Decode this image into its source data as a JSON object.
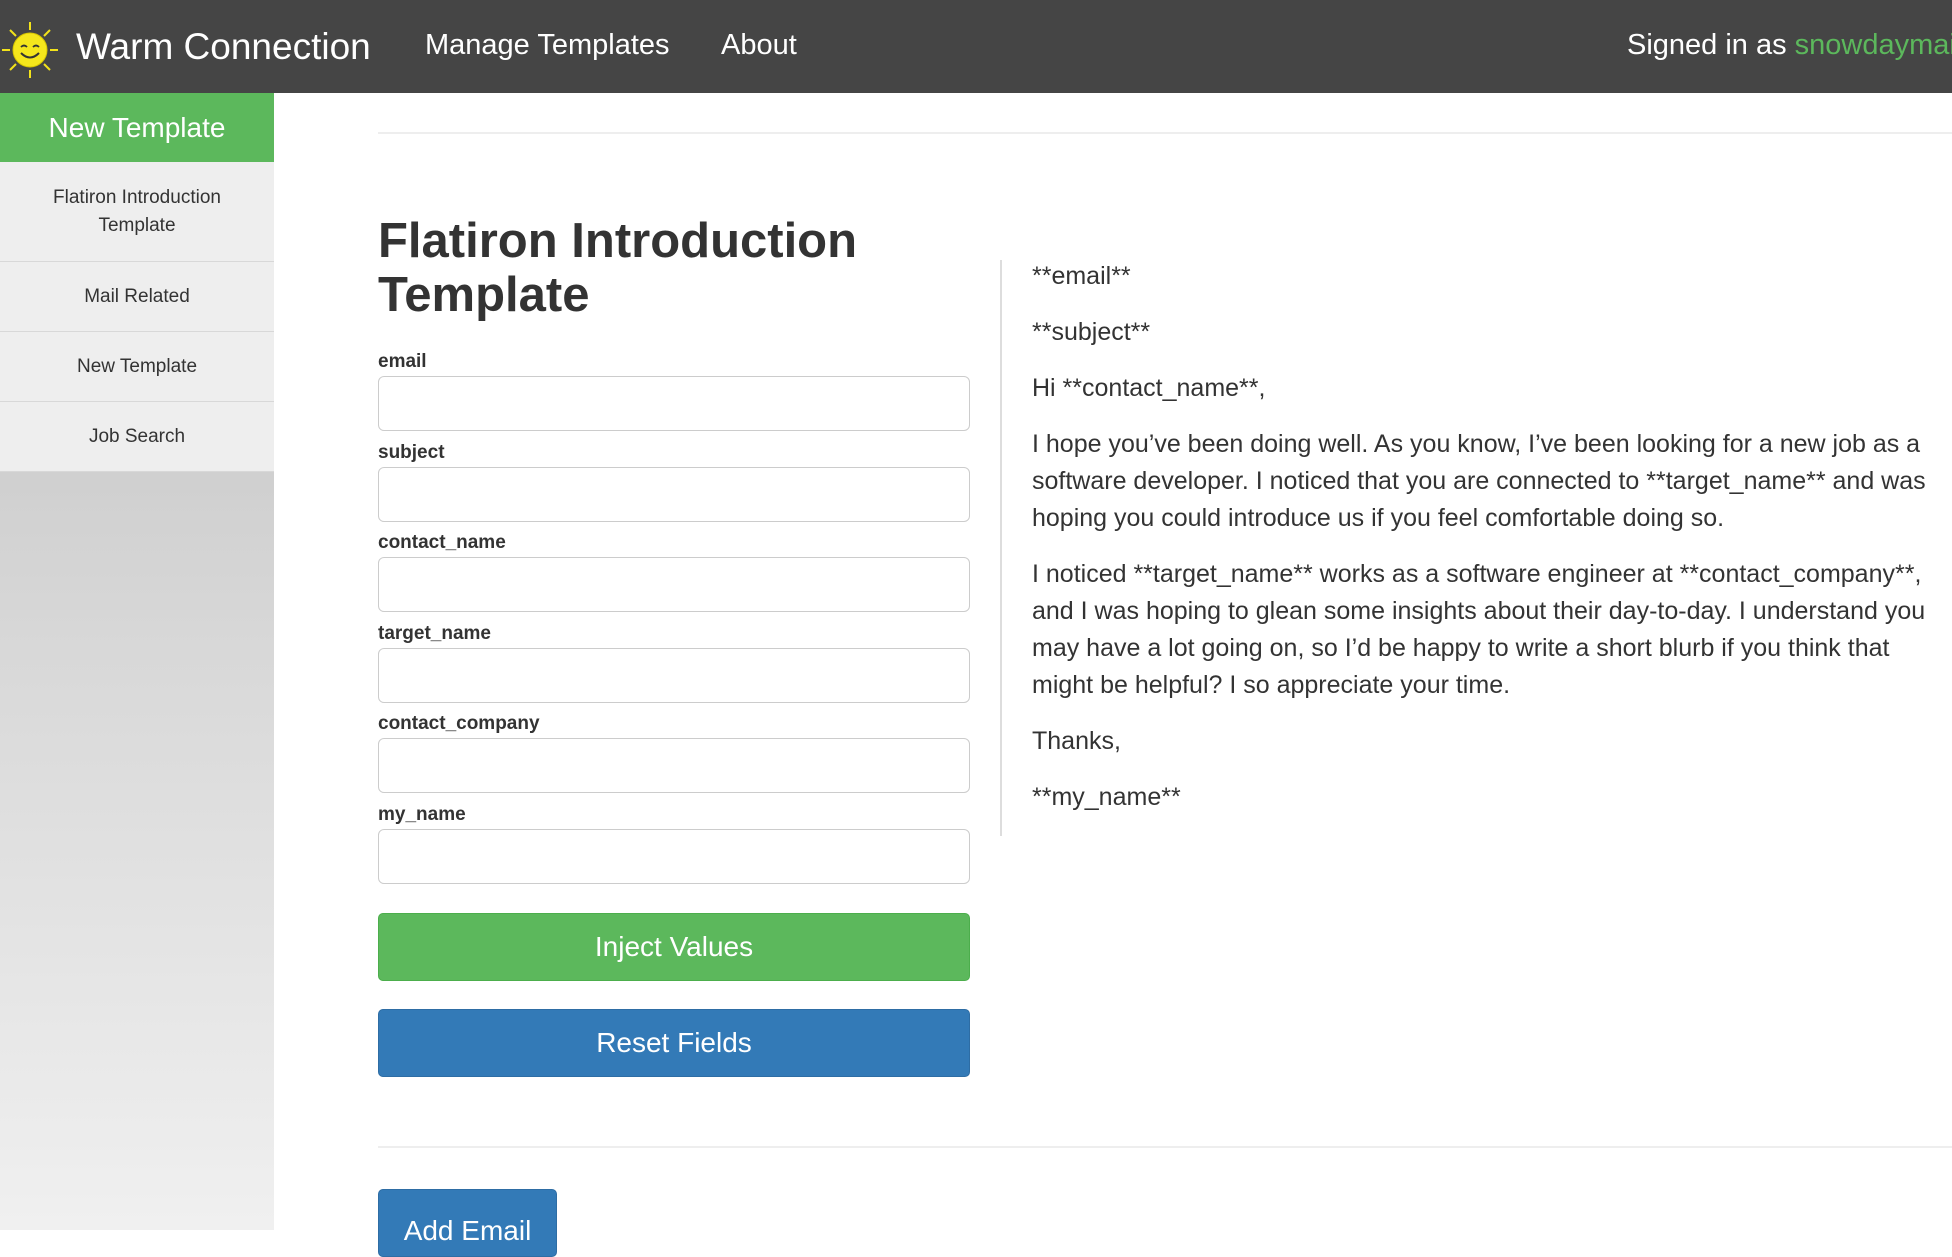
{
  "navbar": {
    "brand": "Warm Connection",
    "logo_icon": "smiling-sun-icon",
    "links": [
      "Manage Templates",
      "About"
    ],
    "signed_in_prefix": "Signed in as ",
    "username": "snowdaymail"
  },
  "sidebar": {
    "new_template_label": "New Template",
    "items": [
      {
        "label": "Flatiron Introduction Template"
      },
      {
        "label": "Mail Related"
      },
      {
        "label": "New Template"
      },
      {
        "label": "Job Search"
      }
    ]
  },
  "main": {
    "title": "Flatiron Introduction Template",
    "fields": [
      {
        "label": "email",
        "value": ""
      },
      {
        "label": "subject",
        "value": ""
      },
      {
        "label": "contact_name",
        "value": ""
      },
      {
        "label": "target_name",
        "value": ""
      },
      {
        "label": "contact_company",
        "value": ""
      },
      {
        "label": "my_name",
        "value": ""
      }
    ],
    "inject_label": "Inject Values",
    "reset_label": "Reset Fields",
    "add_email_label": "Add Email"
  },
  "preview": {
    "email": "**email**",
    "subject": "**subject**",
    "greeting": "Hi **contact_name**,",
    "para1": "I hope you’ve been doing well. As you know, I’ve been looking for a new job as a software developer. I noticed that you are connected to **target_name** and was hoping you could introduce us if you feel comfortable doing so.",
    "para2": "I noticed **target_name** works as a software engineer at **contact_company**, and I was hoping to glean some insights about their day-to-day. I understand you may have a lot going on, so I’d be happy to write a short blurb if you think that might be helpful? I so appreciate your time.",
    "signoff": "Thanks,",
    "name": "**my_name**"
  },
  "colors": {
    "navbar": "#454545",
    "green": "#5cb85c",
    "blue": "#337ab7"
  }
}
